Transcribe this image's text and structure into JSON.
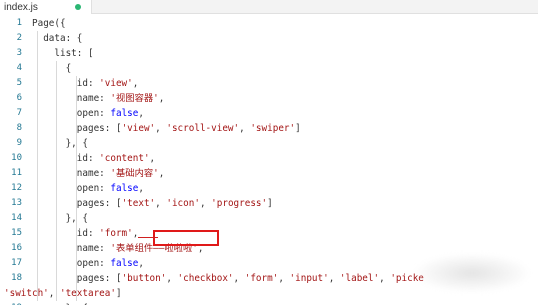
{
  "tab": {
    "filename": "index.js"
  },
  "colors": {
    "accent_dot": "#2bb673",
    "highlight_border": "#e01919"
  },
  "lines": [
    {
      "num": "1",
      "text": "Page({"
    },
    {
      "num": "2",
      "text": "  data: {"
    },
    {
      "num": "3",
      "text": "    list: ["
    },
    {
      "num": "4",
      "text": "      {"
    },
    {
      "num": "5",
      "text": "        id: 'view',"
    },
    {
      "num": "6",
      "text": "        name: '视图容器',"
    },
    {
      "num": "7",
      "text": "        open: false,"
    },
    {
      "num": "8",
      "text": "        pages: ['view', 'scroll-view', 'swiper']"
    },
    {
      "num": "9",
      "text": "      }, {"
    },
    {
      "num": "10",
      "text": "        id: 'content',"
    },
    {
      "num": "11",
      "text": "        name: '基础内容',"
    },
    {
      "num": "12",
      "text": "        open: false,"
    },
    {
      "num": "13",
      "text": "        pages: ['text', 'icon', 'progress']"
    },
    {
      "num": "14",
      "text": "      }, {"
    },
    {
      "num": "15",
      "text": "        id: 'form',"
    },
    {
      "num": "16",
      "text": "        name: '表单组件——啦啦啦',"
    },
    {
      "num": "17",
      "text": "        open: false,"
    },
    {
      "num": "18",
      "text": "        pages: ['button', 'checkbox', 'form', 'input', 'label', 'picke"
    },
    {
      "num": "",
      "text": "'switch', 'textarea']"
    },
    {
      "num": "19",
      "text": "      }, {"
    }
  ]
}
